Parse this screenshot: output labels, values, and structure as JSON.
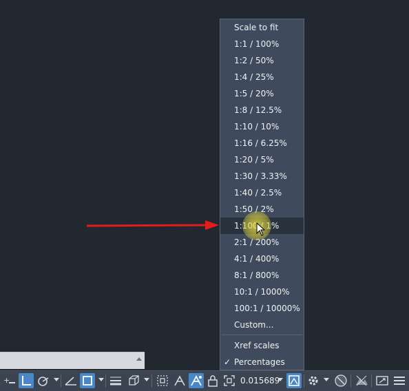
{
  "scale_menu": {
    "items": [
      {
        "label": "Scale to fit"
      },
      {
        "label": "1:1 / 100%"
      },
      {
        "label": "1:2 / 50%"
      },
      {
        "label": "1:4 / 25%"
      },
      {
        "label": "1:5 / 20%"
      },
      {
        "label": "1:8 / 12.5%"
      },
      {
        "label": "1:10 / 10%"
      },
      {
        "label": "1:16 / 6.25%"
      },
      {
        "label": "1:20 / 5%"
      },
      {
        "label": "1:30 / 3.33%"
      },
      {
        "label": "1:40 / 2.5%"
      },
      {
        "label": "1:50 / 2%"
      },
      {
        "label": "1:100 / 1%"
      },
      {
        "label": "2:1 / 200%"
      },
      {
        "label": "4:1 / 400%"
      },
      {
        "label": "8:1 / 800%"
      },
      {
        "label": "10:1 / 1000%"
      },
      {
        "label": "100:1 / 10000%"
      },
      {
        "label": "Custom..."
      }
    ],
    "xref_label": "Xref scales",
    "percentages_label": "Percentages",
    "percentages_checked": true,
    "hovered_item": "1:100 / 1%"
  },
  "statusbar": {
    "scale_value": "0.015689"
  },
  "colors": {
    "menu_bg": "#3f4b5c",
    "hover_bg": "#2a323d",
    "active_button": "#4a87c7",
    "arrow": "#e11d1d"
  }
}
